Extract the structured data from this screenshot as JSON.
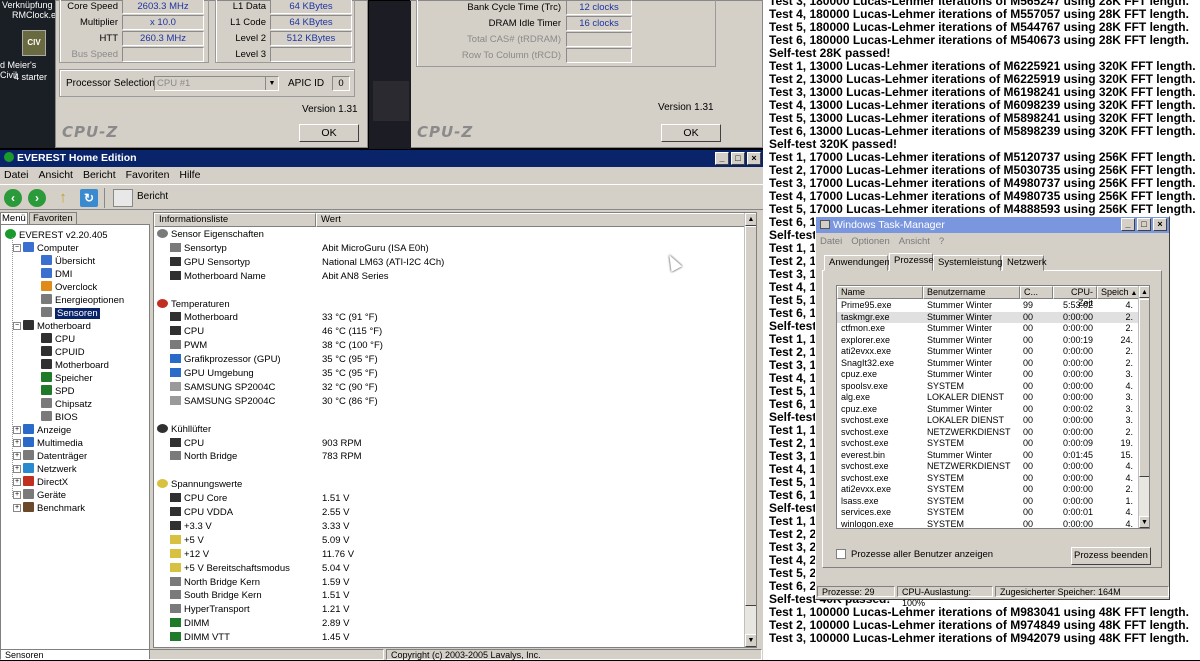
{
  "desktop": {
    "lines": [
      "Verknüpfung",
      "RMClock.e",
      "d Meier's Civil",
      "4 starter"
    ]
  },
  "cpuz_left": {
    "rows_l": [
      {
        "label": "Core Speed",
        "value": "2603.3 MHz",
        "dim": false
      },
      {
        "label": "Multiplier",
        "value": "x 10.0",
        "dim": false
      },
      {
        "label": "HTT",
        "value": "260.3 MHz",
        "dim": false
      },
      {
        "label": "Bus Speed",
        "value": "",
        "dim": true
      }
    ],
    "rows_r": [
      {
        "label": "L1 Data",
        "value": "64 KBytes",
        "dim": false
      },
      {
        "label": "L1 Code",
        "value": "64 KBytes",
        "dim": false
      },
      {
        "label": "Level 2",
        "value": "512 KBytes",
        "dim": false
      },
      {
        "label": "Level 3",
        "value": "",
        "dim": false
      }
    ],
    "proc_sel_label": "Processor Selection",
    "proc_sel_value": "CPU #1",
    "apic_label": "APIC ID",
    "apic_value": "0",
    "version": "Version 1.31",
    "logo": "CPU-Z",
    "ok": "OK"
  },
  "cpuz_right": {
    "rows": [
      {
        "label": "Bank Cycle Time (Trc)",
        "value": "12 clocks",
        "dim": false
      },
      {
        "label": "DRAM Idle Timer",
        "value": "16 clocks",
        "dim": false
      },
      {
        "label": "Total CAS# (tRDRAM)",
        "value": "",
        "dim": true
      },
      {
        "label": "Row To Column (tRCD)",
        "value": "",
        "dim": true
      }
    ],
    "version": "Version 1.31",
    "logo": "CPU-Z",
    "ok": "OK"
  },
  "everest": {
    "title": "EVEREST Home Edition",
    "menu": [
      "Datei",
      "Ansicht",
      "Bericht",
      "Favoriten",
      "Hilfe"
    ],
    "toolbar_report": "Bericht",
    "tabs": [
      "Menü",
      "Favoriten"
    ],
    "tree": [
      {
        "label": "EVEREST v2.20.405",
        "level": 0,
        "pm": "",
        "icon": "#1b9a2c",
        "sel": false
      },
      {
        "label": "Computer",
        "level": 1,
        "pm": "-",
        "icon": "#3b6fd0",
        "sel": false
      },
      {
        "label": "Übersicht",
        "level": 2,
        "pm": "",
        "icon": "#3b6fd0",
        "sel": false
      },
      {
        "label": "DMI",
        "level": 2,
        "pm": "",
        "icon": "#3b6fd0",
        "sel": false
      },
      {
        "label": "Overclock",
        "level": 2,
        "pm": "",
        "icon": "#e08a1a",
        "sel": false
      },
      {
        "label": "Energieoptionen",
        "level": 2,
        "pm": "",
        "icon": "#7a7a7a",
        "sel": false
      },
      {
        "label": "Sensoren",
        "level": 2,
        "pm": "",
        "icon": "#7a7a7a",
        "sel": true
      },
      {
        "label": "Motherboard",
        "level": 1,
        "pm": "-",
        "icon": "#303030",
        "sel": false
      },
      {
        "label": "CPU",
        "level": 2,
        "pm": "",
        "icon": "#303030",
        "sel": false
      },
      {
        "label": "CPUID",
        "level": 2,
        "pm": "",
        "icon": "#303030",
        "sel": false
      },
      {
        "label": "Motherboard",
        "level": 2,
        "pm": "",
        "icon": "#303030",
        "sel": false
      },
      {
        "label": "Speicher",
        "level": 2,
        "pm": "",
        "icon": "#1f7a2a",
        "sel": false
      },
      {
        "label": "SPD",
        "level": 2,
        "pm": "",
        "icon": "#1f7a2a",
        "sel": false
      },
      {
        "label": "Chipsatz",
        "level": 2,
        "pm": "",
        "icon": "#7a7a7a",
        "sel": false
      },
      {
        "label": "BIOS",
        "level": 2,
        "pm": "",
        "icon": "#7a7a7a",
        "sel": false
      },
      {
        "label": "Anzeige",
        "level": 1,
        "pm": "+",
        "icon": "#2a6ac8",
        "sel": false
      },
      {
        "label": "Multimedia",
        "level": 1,
        "pm": "+",
        "icon": "#2a6ac8",
        "sel": false
      },
      {
        "label": "Datenträger",
        "level": 1,
        "pm": "+",
        "icon": "#7a7a7a",
        "sel": false
      },
      {
        "label": "Netzwerk",
        "level": 1,
        "pm": "+",
        "icon": "#2a8ad0",
        "sel": false
      },
      {
        "label": "DirectX",
        "level": 1,
        "pm": "+",
        "icon": "#c03020",
        "sel": false
      },
      {
        "label": "Geräte",
        "level": 1,
        "pm": "+",
        "icon": "#7a7a7a",
        "sel": false
      },
      {
        "label": "Benchmark",
        "level": 1,
        "pm": "+",
        "icon": "#6a4a2a",
        "sel": false
      }
    ],
    "list_headers": [
      "Informationsliste",
      "Wert"
    ],
    "list": [
      {
        "name": "Sensor Eigenschaften",
        "value": "",
        "group": true,
        "icon": "#7a7a7a"
      },
      {
        "name": "Sensortyp",
        "value": "Abit MicroGuru  (ISA E0h)",
        "group": false,
        "icon": "#7a7a7a"
      },
      {
        "name": "GPU Sensortyp",
        "value": "National LM63  (ATI-I2C 4Ch)",
        "group": false,
        "icon": "#303030"
      },
      {
        "name": "Motherboard Name",
        "value": "Abit AN8 Series",
        "group": false,
        "icon": "#303030"
      },
      {
        "name": "",
        "value": "",
        "group": false,
        "icon": ""
      },
      {
        "name": "Temperaturen",
        "value": "",
        "group": true,
        "icon": "#c03020"
      },
      {
        "name": "Motherboard",
        "value": "33 °C  (91 °F)",
        "group": false,
        "icon": "#303030"
      },
      {
        "name": "CPU",
        "value": "46 °C  (115 °F)",
        "group": false,
        "icon": "#303030"
      },
      {
        "name": "PWM",
        "value": "38 °C  (100 °F)",
        "group": false,
        "icon": "#7a7a7a"
      },
      {
        "name": "Grafikprozessor (GPU)",
        "value": "35 °C  (95 °F)",
        "group": false,
        "icon": "#2a6ac8"
      },
      {
        "name": "GPU Umgebung",
        "value": "35 °C  (95 °F)",
        "group": false,
        "icon": "#2a6ac8"
      },
      {
        "name": "SAMSUNG SP2004C",
        "value": "32 °C  (90 °F)",
        "group": false,
        "icon": "#9a9a9a"
      },
      {
        "name": "SAMSUNG SP2004C",
        "value": "30 °C  (86 °F)",
        "group": false,
        "icon": "#9a9a9a"
      },
      {
        "name": "",
        "value": "",
        "group": false,
        "icon": ""
      },
      {
        "name": "Kühllüfter",
        "value": "",
        "group": true,
        "icon": "#303030"
      },
      {
        "name": "CPU",
        "value": "903 RPM",
        "group": false,
        "icon": "#303030"
      },
      {
        "name": "North Bridge",
        "value": "783 RPM",
        "group": false,
        "icon": "#7a7a7a"
      },
      {
        "name": "",
        "value": "",
        "group": false,
        "icon": ""
      },
      {
        "name": "Spannungswerte",
        "value": "",
        "group": true,
        "icon": "#d8c040"
      },
      {
        "name": "CPU Core",
        "value": "1.51 V",
        "group": false,
        "icon": "#303030"
      },
      {
        "name": "CPU VDDA",
        "value": "2.55 V",
        "group": false,
        "icon": "#303030"
      },
      {
        "name": "+3.3 V",
        "value": "3.33 V",
        "group": false,
        "icon": "#303030"
      },
      {
        "name": "+5 V",
        "value": "5.09 V",
        "group": false,
        "icon": "#d8c040"
      },
      {
        "name": "+12 V",
        "value": "11.76 V",
        "group": false,
        "icon": "#d8c040"
      },
      {
        "name": "+5 V Bereitschaftsmodus",
        "value": "5.04 V",
        "group": false,
        "icon": "#d8c040"
      },
      {
        "name": "North Bridge Kern",
        "value": "1.59 V",
        "group": false,
        "icon": "#7a7a7a"
      },
      {
        "name": "South Bridge Kern",
        "value": "1.51 V",
        "group": false,
        "icon": "#7a7a7a"
      },
      {
        "name": "HyperTransport",
        "value": "1.21 V",
        "group": false,
        "icon": "#7a7a7a"
      },
      {
        "name": "DIMM",
        "value": "2.89 V",
        "group": false,
        "icon": "#1f7a2a"
      },
      {
        "name": "DIMM VTT",
        "value": "1.45 V",
        "group": false,
        "icon": "#1f7a2a"
      }
    ],
    "status_left": "Sensoren",
    "status_right": "Copyright (c) 2003-2005 Lavalys, Inc."
  },
  "prime": {
    "lines": [
      "Test 3, 180000 Lucas-Lehmer iterations of M565247 using 28K FFT length.",
      "Test 4, 180000 Lucas-Lehmer iterations of M557057 using 28K FFT length.",
      "Test 5, 180000 Lucas-Lehmer iterations of M544767 using 28K FFT length.",
      "Test 6, 180000 Lucas-Lehmer iterations of M540673 using 28K FFT length.",
      "Self-test 28K passed!",
      "Test 1, 13000 Lucas-Lehmer iterations of M6225921 using 320K FFT length.",
      "Test 2, 13000 Lucas-Lehmer iterations of M6225919 using 320K FFT length.",
      "Test 3, 13000 Lucas-Lehmer iterations of M6198241 using 320K FFT length.",
      "Test 4, 13000 Lucas-Lehmer iterations of M6098239 using 320K FFT length.",
      "Test 5, 13000 Lucas-Lehmer iterations of M5898241 using 320K FFT length.",
      "Test 6, 13000 Lucas-Lehmer iterations of M5898239 using 320K FFT length.",
      "Self-test 320K passed!",
      "Test 1, 17000 Lucas-Lehmer iterations of M5120737 using 256K FFT length.",
      "Test 2, 17000 Lucas-Lehmer iterations of M5030735 using 256K FFT length.",
      "Test 3, 17000 Lucas-Lehmer iterations of M4980737 using 256K FFT length.",
      "Test 4, 17000 Lucas-Lehmer iterations of M4980735 using 256K FFT length.",
      "Test 5, 17000 Lucas-Lehmer iterations of M4888593 using 256K FFT length.",
      "Test 6, 1",
      "Self-test",
      "Test 1, 1",
      "Test 2, 1",
      "Test 3, 1",
      "Test 4, 1",
      "Test 5, 1",
      "Test 6, 1",
      "Self-test",
      "Test 1, 1",
      "Test 2, 1",
      "Test 3, 1",
      "Test 4, 1",
      "Test 5, 1",
      "Test 6, 1",
      "Self-test",
      "Test 1, 1",
      "Test 2, 1",
      "Test 3, 1",
      "Test 4, 1",
      "Test 5, 1",
      "Test 6, 1",
      "Self-test",
      "Test 1, 1",
      "Test 2, 2",
      "Test 3, 2",
      "Test 4, 2",
      "Test 5, 2",
      "Test 6, 2",
      "Self-test 40K passed!",
      "Test 1, 100000 Lucas-Lehmer iterations of M983041 using 48K FFT length.",
      "Test 2, 100000 Lucas-Lehmer iterations of M974849 using 48K FFT length.",
      "Test 3, 100000 Lucas-Lehmer iterations of M942079 using 48K FFT length."
    ]
  },
  "taskmgr": {
    "title": "Windows Task-Manager",
    "menu": [
      "Datei",
      "Optionen",
      "Ansicht",
      "?"
    ],
    "tabs": [
      "Anwendungen",
      "Prozesse",
      "Systemleistung",
      "Netzwerk"
    ],
    "headers": [
      "Name",
      "Benutzername",
      "C...",
      "CPU-Zeit",
      "Speich"
    ],
    "rows": [
      [
        "Prime95.exe",
        "Stummer Winter",
        "99",
        "5:53:02",
        "4."
      ],
      [
        "taskmgr.exe",
        "Stummer Winter",
        "00",
        "0:00:00",
        "2."
      ],
      [
        "ctfmon.exe",
        "Stummer Winter",
        "00",
        "0:00:00",
        "2."
      ],
      [
        "explorer.exe",
        "Stummer Winter",
        "00",
        "0:00:19",
        "24."
      ],
      [
        "ati2evxx.exe",
        "Stummer Winter",
        "00",
        "0:00:00",
        "2."
      ],
      [
        "SnagIt32.exe",
        "Stummer Winter",
        "00",
        "0:00:00",
        "2."
      ],
      [
        "cpuz.exe",
        "Stummer Winter",
        "00",
        "0:00:00",
        "3."
      ],
      [
        "spoolsv.exe",
        "SYSTEM",
        "00",
        "0:00:00",
        "4."
      ],
      [
        "alg.exe",
        "LOKALER DIENST",
        "00",
        "0:00:00",
        "3."
      ],
      [
        "cpuz.exe",
        "Stummer Winter",
        "00",
        "0:00:02",
        "3."
      ],
      [
        "svchost.exe",
        "LOKALER DIENST",
        "00",
        "0:00:00",
        "3."
      ],
      [
        "svchost.exe",
        "NETZWERKDIENST",
        "00",
        "0:00:00",
        "2."
      ],
      [
        "svchost.exe",
        "SYSTEM",
        "00",
        "0:00:09",
        "19."
      ],
      [
        "everest.bin",
        "Stummer Winter",
        "00",
        "0:01:45",
        "15."
      ],
      [
        "svchost.exe",
        "NETZWERKDIENST",
        "00",
        "0:00:00",
        "4."
      ],
      [
        "svchost.exe",
        "SYSTEM",
        "00",
        "0:00:00",
        "4."
      ],
      [
        "ati2evxx.exe",
        "SYSTEM",
        "00",
        "0:00:00",
        "2."
      ],
      [
        "lsass.exe",
        "SYSTEM",
        "00",
        "0:00:00",
        "1."
      ],
      [
        "services.exe",
        "SYSTEM",
        "00",
        "0:00:01",
        "4."
      ],
      [
        "winlogon.exe",
        "SYSTEM",
        "00",
        "0:00:00",
        "4."
      ]
    ],
    "show_all": "Prozesse aller Benutzer anzeigen",
    "end_btn": "Prozess beenden",
    "status": [
      "Prozesse: 29",
      "CPU-Auslastung: 100%",
      "Zugesicherter Speicher: 164M"
    ]
  }
}
